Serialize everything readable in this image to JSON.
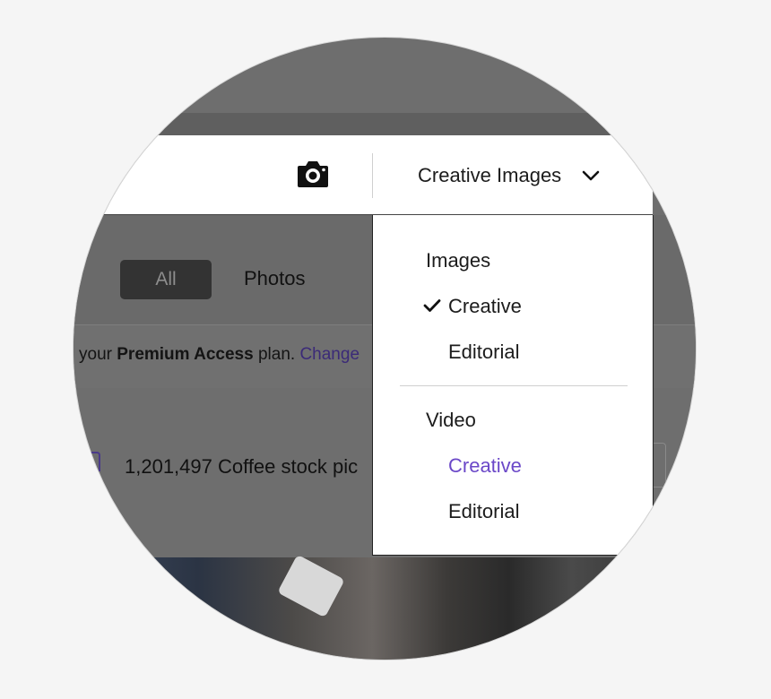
{
  "header": {
    "camera_icon": "camera-icon",
    "type_toggle_label": "Creative Images",
    "chevron_icon": "chevron-down-icon"
  },
  "filters": {
    "all_label": "All",
    "photos_label": "Photos"
  },
  "notice": {
    "prefix": "your ",
    "plan": "Premium Access",
    "middle": " plan. ",
    "link": "Change"
  },
  "results": {
    "count_text": "1,201,497 Coffee stock pic"
  },
  "dropdown": {
    "images_heading": "Images",
    "images_creative": "Creative",
    "images_editorial": "Editorial",
    "video_heading": "Video",
    "video_creative": "Creative",
    "video_editorial": "Editorial",
    "selected": "Images > Creative",
    "hovered": "Video > Creative"
  },
  "colors": {
    "accent_purple": "#6b48c8",
    "link_purple": "#3b2a78",
    "overlay_gray": "#6e6e6e",
    "pill_dark": "#333333"
  }
}
